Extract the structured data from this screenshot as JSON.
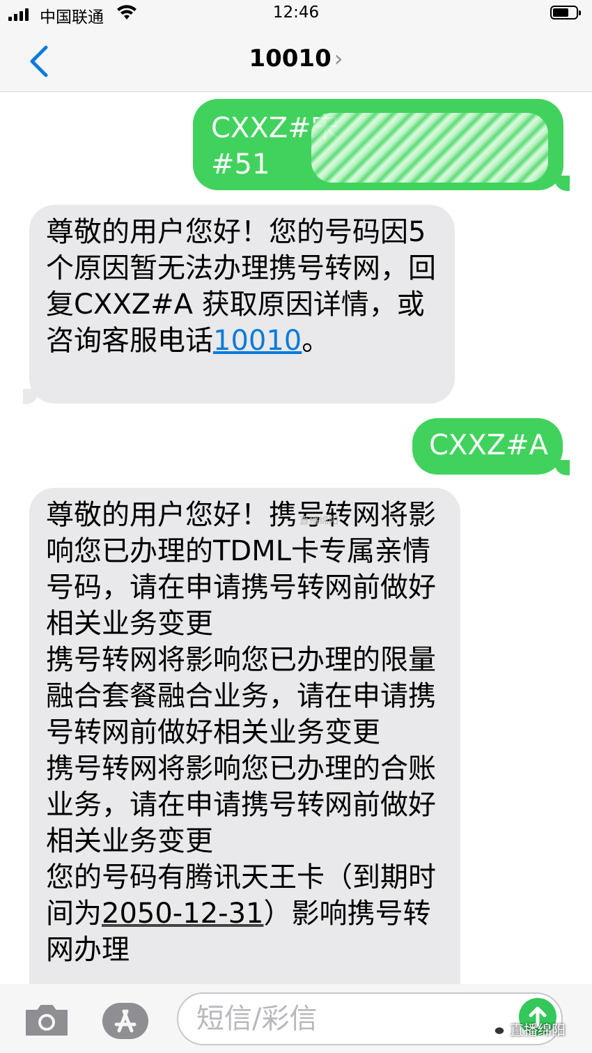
{
  "status_bar": {
    "carrier": "中国联通",
    "time": "12:46"
  },
  "nav": {
    "title": "10010",
    "chevron": "›"
  },
  "messages": [
    {
      "direction": "sent",
      "lines": [
        "CXXZ#宋",
        "#51"
      ]
    },
    {
      "direction": "received",
      "text_1": "尊敬的用户您好！您的号码因5个原因暂无法办理携号转网，回复CXXZ#A 获取原因详情，或咨询客服电话",
      "link": "10010",
      "text_2": "。"
    },
    {
      "direction": "sent",
      "text": "CXXZ#A"
    },
    {
      "direction": "received",
      "watermark": "直播绵阳",
      "paragraphs": [
        "尊敬的用户您好！携号转网将影响您已办理的TDML卡专属亲情号码，请在申请携号转网前做好相关业务变更",
        " 携号转网将影响您已办理的限量融合套餐融合业务，请在申请携号转网前做好相关业务变更",
        " 携号转网将影响您已办理的合账业务，请在申请携号转网前做好相关业务变更"
      ],
      "last_pre": " 您的号码有腾讯天王卡（到期时间为",
      "last_date": "2050-12-31",
      "last_post": "）影响携号转网办理"
    }
  ],
  "input": {
    "placeholder": "短信/彩信"
  },
  "icons": {
    "camera": "camera-icon",
    "appstore": "app-store-icon",
    "send": "send-arrow-icon",
    "back": "back-chevron-icon"
  },
  "brand": {
    "name": "直播绵阳"
  },
  "colors": {
    "sent": "#41d25d",
    "received": "#e9e9eb",
    "link": "#0a7bd9",
    "send_button": "#34c759"
  }
}
